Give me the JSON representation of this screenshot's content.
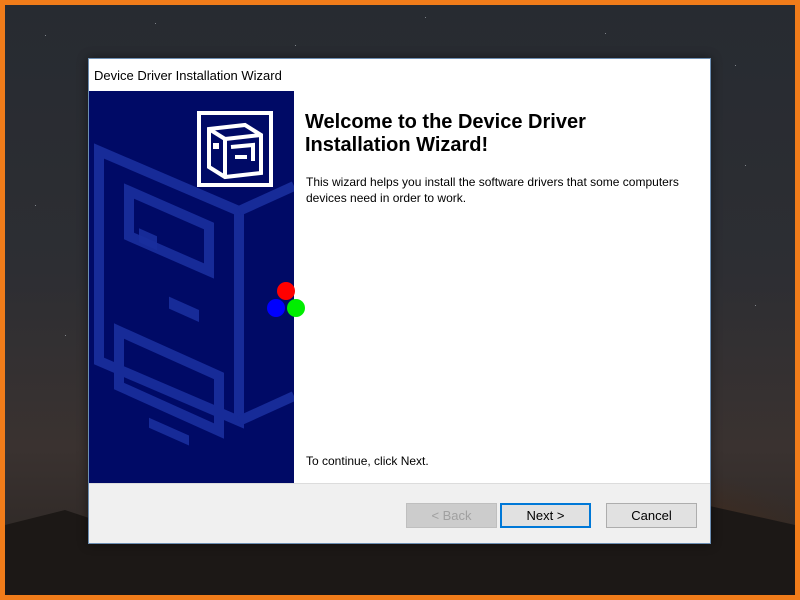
{
  "window": {
    "title": "Device Driver Installation Wizard"
  },
  "content": {
    "heading_line1": "Welcome to the Device Driver",
    "heading_line2": "Installation Wizard!",
    "description": "This wizard helps you install the software drivers that some computers devices need in order to work.",
    "continue_text": "To continue, click Next."
  },
  "buttons": {
    "back": "< Back",
    "next": "Next >",
    "cancel": "Cancel"
  },
  "icons": {
    "logo": "device-box-icon"
  },
  "colors": {
    "side_panel": "#000a66",
    "accent": "#0078d7",
    "desktop_border": "#f07c1a",
    "marker_red": "#ff0000",
    "marker_green": "#00ee00",
    "marker_blue": "#0000ff"
  }
}
